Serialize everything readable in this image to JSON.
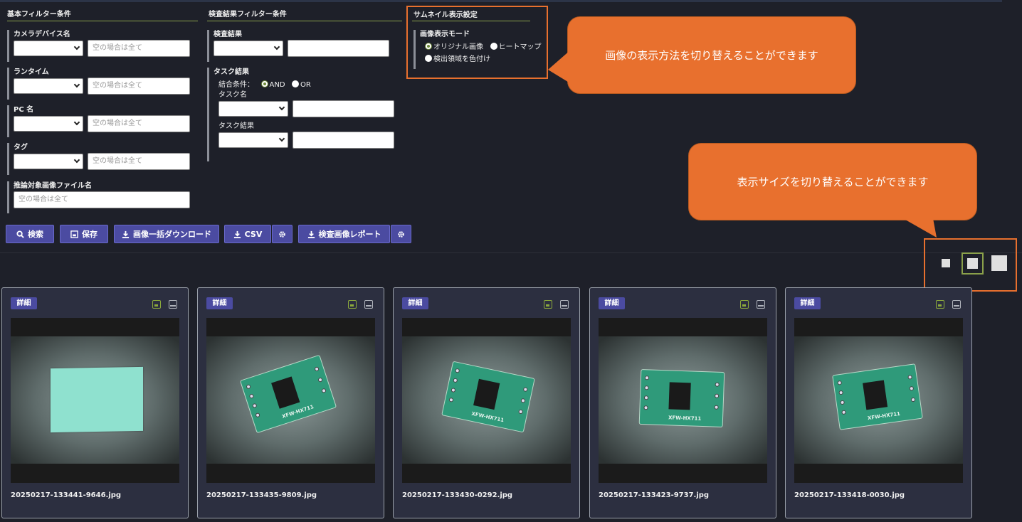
{
  "basic_filter": {
    "title": "基本フィルター条件",
    "camera": {
      "label": "カメラデバイス名",
      "placeholder": "空の場合は全て"
    },
    "runtime": {
      "label": "ランタイム",
      "placeholder": "空の場合は全て"
    },
    "pc": {
      "label": "PC 名",
      "placeholder": "空の場合は全て"
    },
    "tag": {
      "label": "タグ",
      "placeholder": "空の場合は全て"
    },
    "filename": {
      "label": "推論対象画像ファイル名",
      "placeholder": "空の場合は全て"
    }
  },
  "result_filter": {
    "title": "検査結果フィルター条件",
    "result_label": "検査結果",
    "task_label": "タスク結果",
    "combine_label": "結合条件：",
    "and_label": "AND",
    "or_label": "OR",
    "task_name_label": "タスク名",
    "task_result_label": "タスク結果"
  },
  "thumb_settings": {
    "title": "サムネイル表示設定",
    "mode_label": "画像表示モード",
    "original": "オリジナル画像",
    "heatmap": "ヒートマップ",
    "colorize": "検出領域を色付け"
  },
  "buttons": {
    "search": "検索",
    "save": "保存",
    "bulk_download": "画像一括ダウンロード",
    "csv": "CSV",
    "report": "検査画像レポート"
  },
  "callouts": {
    "mode": "画像の表示方法を切り替えることができます",
    "size": "表示サイズを切り替えることができます"
  },
  "cards": [
    {
      "badge": "詳細",
      "filename": "20250217-133441-9646.jpg"
    },
    {
      "badge": "詳細",
      "filename": "20250217-133435-9809.jpg"
    },
    {
      "badge": "詳細",
      "filename": "20250217-133430-0292.jpg"
    },
    {
      "badge": "詳細",
      "filename": "20250217-133423-9737.jpg"
    },
    {
      "badge": "詳細",
      "filename": "20250217-133418-0030.jpg"
    }
  ],
  "colors": {
    "accent": "#4b4ba1",
    "callout": "#e8702e",
    "highlight": "#8aa04a"
  },
  "icons": [
    "search-icon",
    "save-icon",
    "download-icon",
    "gear-icon",
    "image-icon",
    "monitor-icon"
  ]
}
